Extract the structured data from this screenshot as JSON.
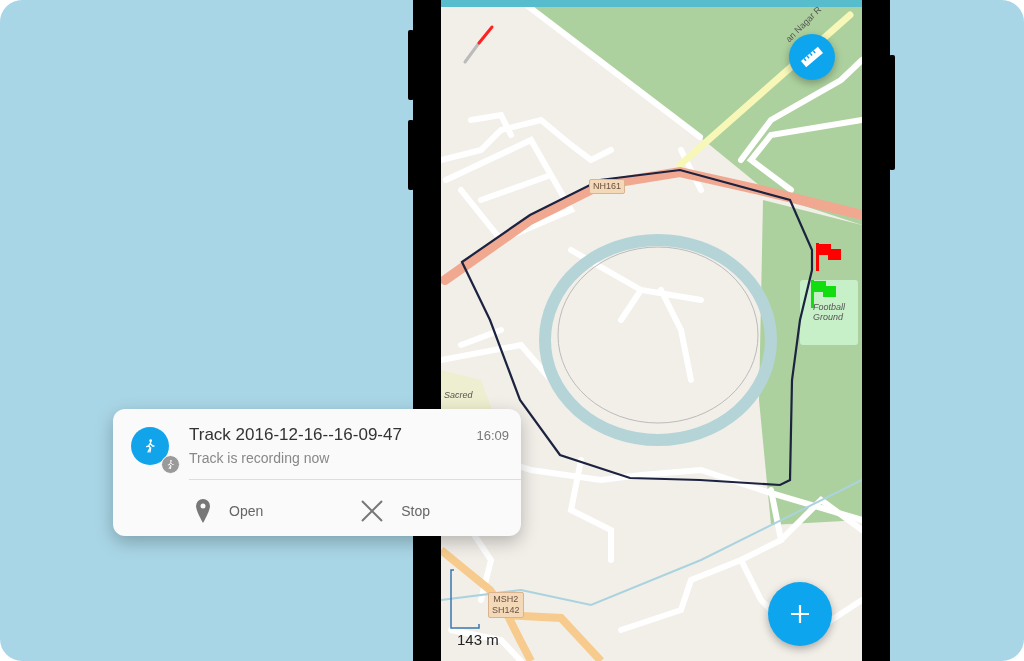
{
  "map": {
    "street_label": "an Nagar R",
    "road_shield": "NH161",
    "place_label": "Sacred",
    "park_label": "Football Ground",
    "route_shield": [
      "MSH2",
      "SH142"
    ],
    "scale": "143 m",
    "markers": [
      {
        "color": "#ff0000"
      },
      {
        "color": "#11dd11"
      }
    ]
  },
  "notification": {
    "title": "Track 2016-12-16--16-09-47",
    "time": "16:09",
    "text": "Track is recording now",
    "actions": [
      {
        "kind": "open",
        "label": "Open"
      },
      {
        "kind": "stop",
        "label": "Stop"
      }
    ]
  }
}
